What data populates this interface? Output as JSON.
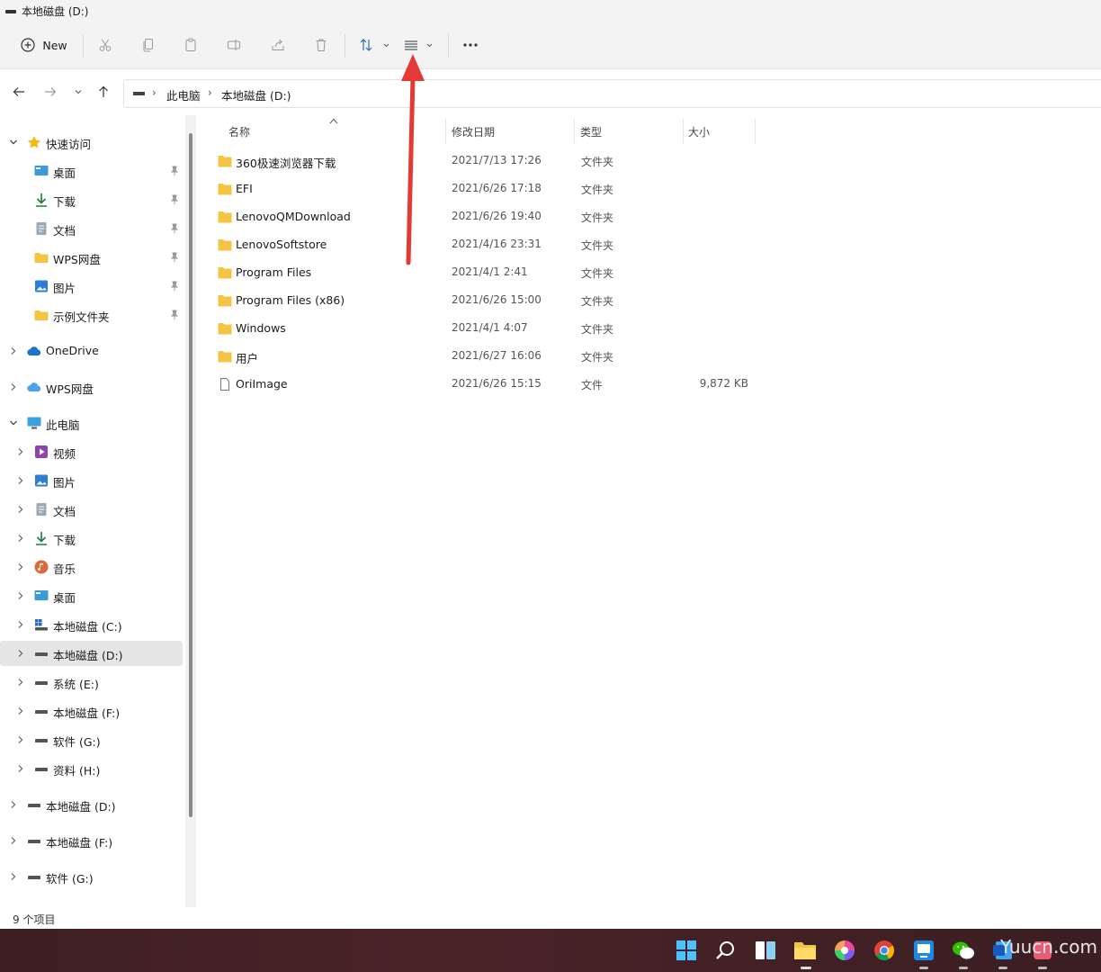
{
  "window": {
    "title": "本地磁盘 (D:)"
  },
  "toolbar": {
    "new_label": "New",
    "buttons": [
      "cut-icon",
      "copy-icon",
      "paste-icon",
      "rename-icon",
      "share-icon",
      "delete-icon",
      "sort-icon",
      "view-icon",
      "more-icon"
    ]
  },
  "address": {
    "crumbs": [
      "此电脑",
      "本地磁盘 (D:)"
    ]
  },
  "sidebar": {
    "quick_access": "快速访问",
    "quick_items": [
      "桌面",
      "下载",
      "文档",
      "WPS网盘",
      "图片",
      "示例文件夹"
    ],
    "onedrive": "OneDrive",
    "wps_cloud": "WPS网盘",
    "this_pc": "此电脑",
    "pc_items": [
      "视频",
      "图片",
      "文档",
      "下载",
      "音乐",
      "桌面",
      "本地磁盘 (C:)",
      "本地磁盘 (D:)",
      "系统 (E:)",
      "本地磁盘 (F:)",
      "软件 (G:)",
      "资料 (H:)"
    ],
    "extra_drives": [
      "本地磁盘 (D:)",
      "本地磁盘 (F:)",
      "软件 (G:)"
    ]
  },
  "columns": {
    "name": "名称",
    "date": "修改日期",
    "type": "类型",
    "size": "大小"
  },
  "files": [
    {
      "name": "360极速浏览器下载",
      "date": "2021/7/13 17:26",
      "type": "文件夹",
      "size": ""
    },
    {
      "name": "EFI",
      "date": "2021/6/26 17:18",
      "type": "文件夹",
      "size": ""
    },
    {
      "name": "LenovoQMDownload",
      "date": "2021/6/26 19:40",
      "type": "文件夹",
      "size": ""
    },
    {
      "name": "LenovoSoftstore",
      "date": "2021/4/16 23:31",
      "type": "文件夹",
      "size": ""
    },
    {
      "name": "Program Files",
      "date": "2021/4/1 2:41",
      "type": "文件夹",
      "size": ""
    },
    {
      "name": "Program Files (x86)",
      "date": "2021/6/26 15:00",
      "type": "文件夹",
      "size": ""
    },
    {
      "name": "Windows",
      "date": "2021/4/1 4:07",
      "type": "文件夹",
      "size": ""
    },
    {
      "name": "用户",
      "date": "2021/6/27 16:06",
      "type": "文件夹",
      "size": ""
    },
    {
      "name": "OriImage",
      "date": "2021/6/26 15:15",
      "type": "文件",
      "size": "9,872 KB"
    }
  ],
  "status": {
    "count": "9 个项目"
  },
  "watermark": "Yuucn.com",
  "colors": {
    "accent": "#e53935",
    "folder": "#f4c542",
    "taskbar": "#3d1f22"
  }
}
